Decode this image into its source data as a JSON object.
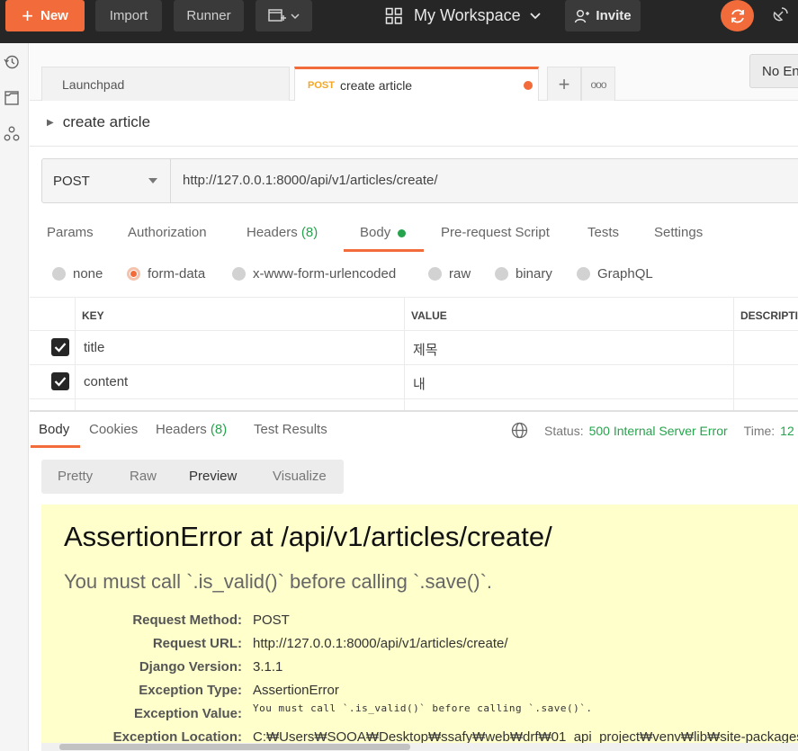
{
  "topbar": {
    "new_label": "New",
    "import_label": "Import",
    "runner_label": "Runner",
    "workspace_label": "My Workspace",
    "invite_label": "Invite"
  },
  "tabs": {
    "launchpad_label": "Launchpad",
    "active_method": "POST",
    "active_label": "create article",
    "plus_label": "+",
    "more_label": "ooo"
  },
  "environment": {
    "label": "No Environment"
  },
  "request": {
    "name": "create article",
    "method": "POST",
    "url": "http://127.0.0.1:8000/api/v1/articles/create/"
  },
  "request_tabs": {
    "params": "Params",
    "authorization": "Authorization",
    "headers": "Headers",
    "headers_count": "(8)",
    "body": "Body",
    "prerequest": "Pre-request Script",
    "tests": "Tests",
    "settings": "Settings"
  },
  "body_types": {
    "none": "none",
    "form_data": "form-data",
    "urlencoded": "x-www-form-urlencoded",
    "raw": "raw",
    "binary": "binary",
    "graphql": "GraphQL",
    "selected": "form-data"
  },
  "kv_table": {
    "headers": {
      "key": "KEY",
      "value": "VALUE",
      "description": "DESCRIPTION"
    },
    "rows": [
      {
        "key": "title",
        "value": "제목",
        "checked": true
      },
      {
        "key": "content",
        "value": "내",
        "checked": true
      }
    ]
  },
  "response": {
    "tabs": {
      "body": "Body",
      "cookies": "Cookies",
      "headers": "Headers",
      "headers_count": "(8)",
      "test_results": "Test Results"
    },
    "status_label": "Status:",
    "status_value": "500 Internal Server Error",
    "time_label": "Time:",
    "time_value": "12",
    "view_tabs": {
      "pretty": "Pretty",
      "raw": "Raw",
      "preview": "Preview",
      "visualize": "Visualize",
      "active": "Preview"
    }
  },
  "error_page": {
    "title": "AssertionError at /api/v1/articles/create/",
    "subtitle": "You must call `.is_valid()` before calling `.save()`.",
    "meta": [
      {
        "key": "Request Method:",
        "value": "POST"
      },
      {
        "key": "Request URL:",
        "value": "http://127.0.0.1:8000/api/v1/articles/create/"
      },
      {
        "key": "Django Version:",
        "value": "3.1.1"
      },
      {
        "key": "Exception Type:",
        "value": "AssertionError"
      },
      {
        "key": "Exception Value:",
        "value": "You must call `.is_valid()` before calling `.save()`."
      },
      {
        "key": "Exception Location:",
        "value": "C:₩Users₩SOOA₩Desktop₩ssafy₩web₩drf₩01_api_project₩venv₩lib₩site-packages"
      }
    ]
  },
  "colors": {
    "accent": "#f26b3a",
    "topbar": "#262626",
    "success_green": "#26a34d",
    "error_bg": "#ffffcc"
  },
  "icons": [
    "plus-icon",
    "new-window-icon",
    "chevron-down-icon",
    "grid-icon",
    "invite-icon",
    "sync-icon",
    "satellite-icon",
    "history-icon",
    "collections-icon",
    "apis-icon",
    "globe-icon",
    "checkbox-icon",
    "caret-right-icon"
  ]
}
